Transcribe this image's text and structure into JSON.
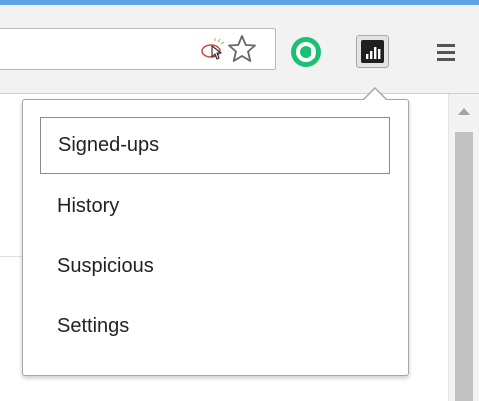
{
  "toolbar": {
    "icons": [
      "cast-icon",
      "bookmark-star-icon",
      "green-extension-icon",
      "bar-chart-extension-icon",
      "menu-icon"
    ],
    "colors": {
      "frame_accent": "#5fa2e6",
      "green_extension": "#1dbf73",
      "chart_extension": "#1f1f1f"
    }
  },
  "dropdown": {
    "items": [
      {
        "label": "Signed-ups",
        "selected": true
      },
      {
        "label": "History",
        "selected": false
      },
      {
        "label": "Suspicious",
        "selected": false
      },
      {
        "label": "Settings",
        "selected": false
      }
    ]
  }
}
